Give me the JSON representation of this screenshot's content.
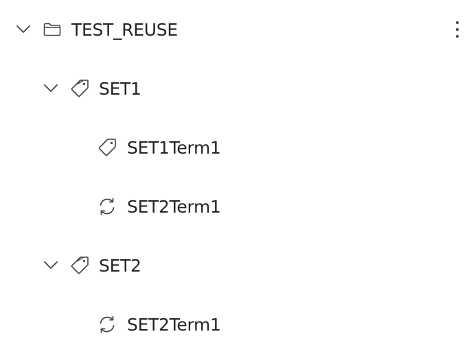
{
  "tree": {
    "root": {
      "label": "TEST_REUSE",
      "icon": "folder-icon",
      "expanded": true
    },
    "nodes": [
      {
        "label": "SET1",
        "icon": "tag-icon",
        "level": 1,
        "expanded": true
      },
      {
        "label": "SET1Term1",
        "icon": "tag-icon",
        "level": 2
      },
      {
        "label": "SET2Term1",
        "icon": "sync-icon",
        "level": 2
      },
      {
        "label": "SET2",
        "icon": "tag-icon",
        "level": 1,
        "expanded": true
      },
      {
        "label": "SET2Term1",
        "icon": "sync-icon",
        "level": 2
      }
    ]
  },
  "colors": {
    "text": "#242424",
    "icon": "#424242",
    "background": "#ffffff"
  }
}
